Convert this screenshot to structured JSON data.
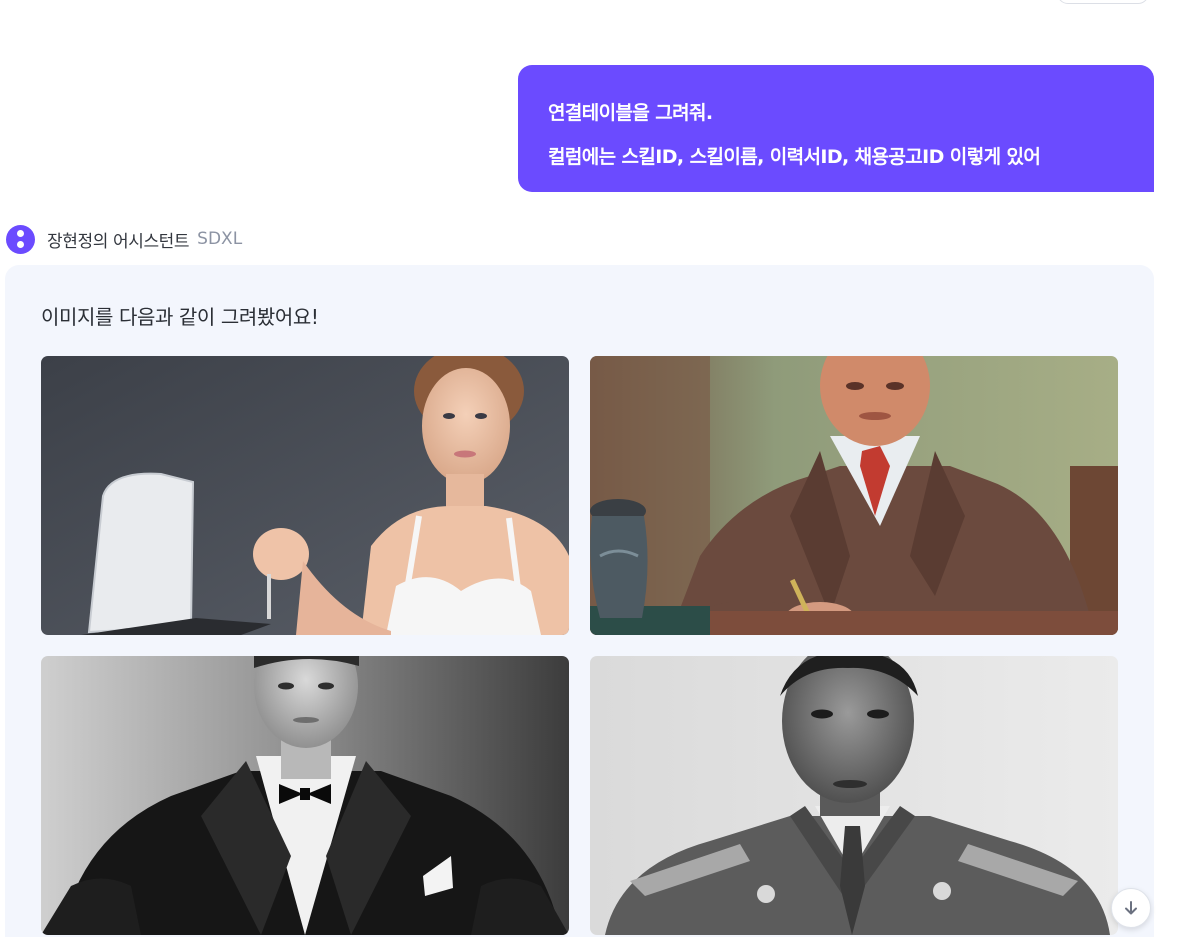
{
  "user_message": {
    "line1": "연결테이블을 그려줘.",
    "line2": "컬럼에는 스킬ID, 스킬이름, 이력서ID, 채용공고ID 이렇게 있어"
  },
  "assistant": {
    "name": "장현정의 어시스턴트",
    "model": "SDXL",
    "avatar_icon": "assistant-dots-icon",
    "message": "이미지를 다음과 같이 그려봤어요!"
  },
  "images": [
    {
      "subject": "woman-with-laptop-photo"
    },
    {
      "subject": "older-man-oil-painting"
    },
    {
      "subject": "man-in-tuxedo-bw-photo"
    },
    {
      "subject": "man-in-uniform-bw-photo"
    }
  ],
  "scroll_button": {
    "icon": "arrow-down-icon"
  },
  "colors": {
    "accent": "#6b4bff",
    "card_background": "#f3f6fd",
    "text": "#2b2f36",
    "muted": "#8c93a3"
  }
}
